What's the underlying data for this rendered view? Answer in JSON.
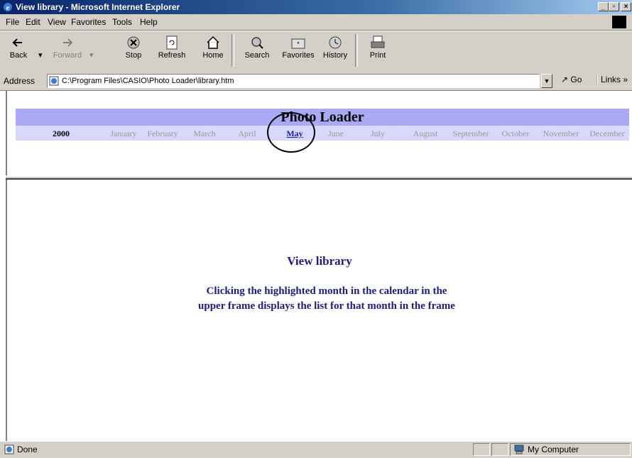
{
  "window": {
    "title": "View library - Microsoft Internet Explorer"
  },
  "menu": [
    "File",
    "Edit",
    "View",
    "Favorites",
    "Tools",
    "Help"
  ],
  "toolbar": {
    "back": "Back",
    "forward": "Forward",
    "stop": "Stop",
    "refresh": "Refresh",
    "home": "Home",
    "search": "Search",
    "favorites": "Favorites",
    "history": "History",
    "print": "Print"
  },
  "address": {
    "label": "Address",
    "url": "C:\\Program Files\\CASIO\\Photo Loader\\library.htm",
    "go": "Go",
    "links": "Links"
  },
  "calendar": {
    "title": "Photo Loader",
    "year": "2000",
    "months": [
      "January",
      "February",
      "March",
      "April",
      "May",
      "June",
      "July",
      "August",
      "September",
      "October",
      "November",
      "December"
    ],
    "active_month": "May"
  },
  "content": {
    "heading": "View library",
    "line1": "Clicking the highlighted month in the calendar in the",
    "line2": "upper frame displays the list for that month in the frame"
  },
  "status": {
    "text": "Done",
    "zone": "My Computer"
  }
}
